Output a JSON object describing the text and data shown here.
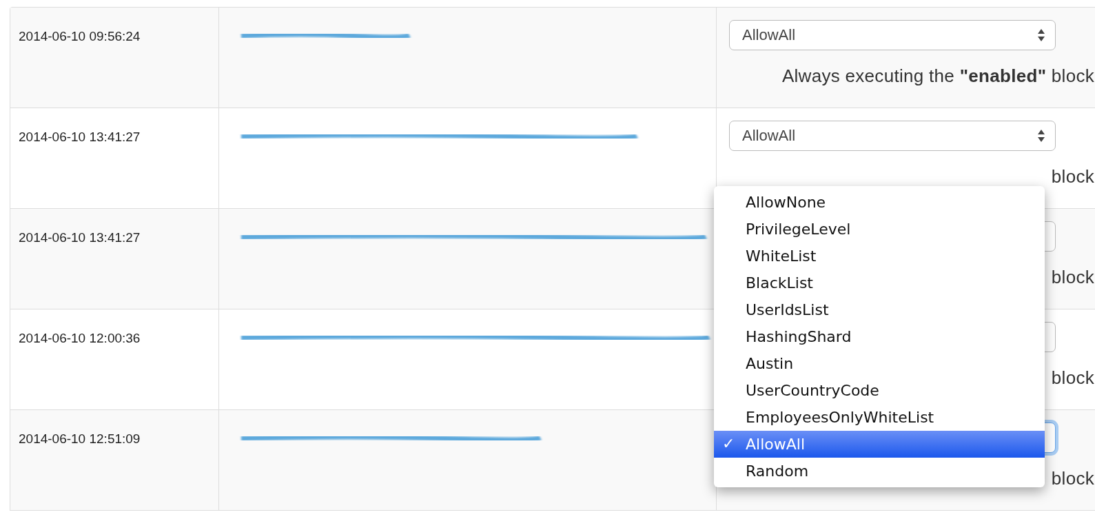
{
  "table": {
    "rows": [
      {
        "time": "2014-06-10 09:56:24",
        "redacted": true,
        "policy": "AllowAll",
        "focused": false,
        "description": "Always executing the **\"enabled\"** block"
      },
      {
        "time": "2014-06-10 13:41:27",
        "redacted": true,
        "policy": "AllowAll",
        "focused": false,
        "description": "block"
      },
      {
        "time": "2014-06-10 13:41:27",
        "redacted": true,
        "focused": false,
        "description": "block"
      },
      {
        "time": "2014-06-10 12:00:36",
        "redacted": true,
        "focused": false,
        "description": "block"
      },
      {
        "time": "2014-06-10 12:51:09",
        "redacted": true,
        "focused": true,
        "description": "block"
      }
    ]
  },
  "dropdown_menu": {
    "check_mark": "✓",
    "options": [
      {
        "label": "AllowNone",
        "selected": false
      },
      {
        "label": "PrivilegeLevel",
        "selected": false
      },
      {
        "label": "WhiteList",
        "selected": false
      },
      {
        "label": "BlackList",
        "selected": false
      },
      {
        "label": "UserIdsList",
        "selected": false
      },
      {
        "label": "HashingShard",
        "selected": false
      },
      {
        "label": "Austin",
        "selected": false
      },
      {
        "label": "UserCountryCode",
        "selected": false
      },
      {
        "label": "EmployeesOnlyWhiteList",
        "selected": false
      },
      {
        "label": "AllowAll",
        "selected": true
      },
      {
        "label": "Random",
        "selected": false
      }
    ]
  }
}
